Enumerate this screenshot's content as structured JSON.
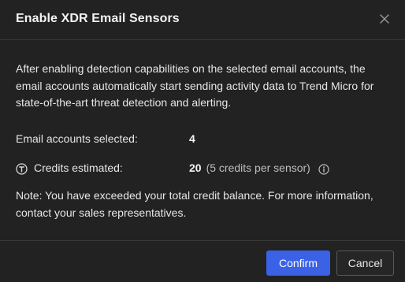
{
  "dialog": {
    "title": "Enable XDR Email Sensors",
    "close_icon": "close-icon",
    "description": "After enabling detection capabilities on the selected email accounts, the email accounts automatically start sending activity data to Trend Micro for state-of-the-art threat detection and alerting.",
    "accounts": {
      "label": "Email accounts selected:",
      "value": "4"
    },
    "credits": {
      "icon": "credit-token-icon",
      "label": "Credits estimated:",
      "value": "20",
      "detail": "(5 credits per sensor)",
      "info_icon": "info-icon"
    },
    "note": "Note: You have exceeded your total credit balance. For more information, contact your sales representatives.",
    "buttons": {
      "confirm": "Confirm",
      "cancel": "Cancel"
    }
  },
  "colors": {
    "background": "#222222",
    "primary_button": "#3b61e6",
    "divider": "#3a3a3a",
    "text": "#e6e6e6"
  }
}
